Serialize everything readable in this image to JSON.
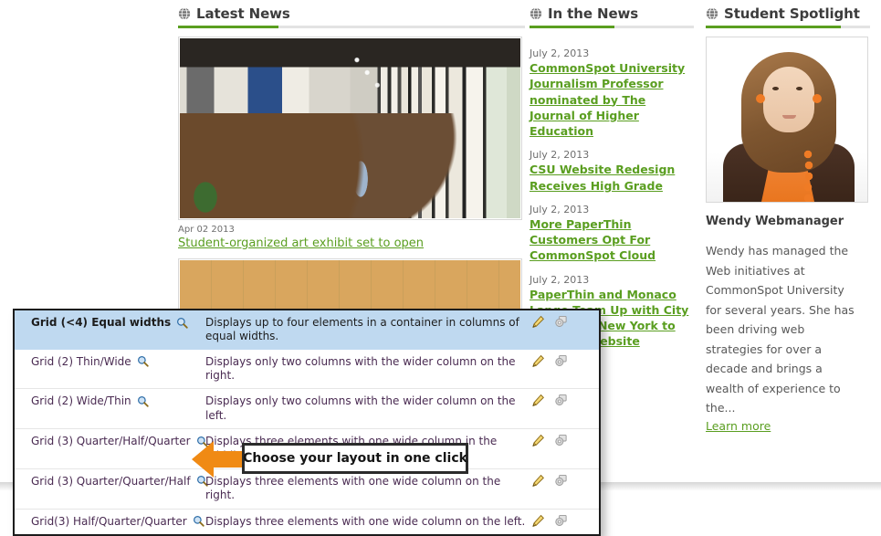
{
  "sections": {
    "latest_news": {
      "title": "Latest News",
      "icon": "globe-icon",
      "featured": {
        "date": "Apr 02 2013",
        "headline": "Student-organized art exhibit set to open",
        "image_alt": "art-gallery-photo"
      },
      "second_image_alt": "group-photo"
    },
    "in_the_news": {
      "title": "In the News",
      "icon": "globe-icon",
      "items": [
        {
          "date": "July 2, 2013",
          "headline": "CommonSpot University Journalism Professor nominated by The Journal of Higher Education"
        },
        {
          "date": "July 2, 2013",
          "headline": "CSU Website Redesign Receives High Grade"
        },
        {
          "date": "July 2, 2013",
          "headline": "More PaperThin Customers Opt For CommonSpot Cloud"
        },
        {
          "date": "July 2, 2013",
          "headline": "PaperThin and Monaco Lange Team Up with City College of New York to Rebrand Website"
        }
      ]
    },
    "student_spotlight": {
      "title": "Student Spotlight",
      "icon": "globe-icon",
      "photo_alt": "student-portrait",
      "name": "Wendy Webmanager",
      "bio": "Wendy has managed the Web initiatives at CommonSpot University for several years. She has been driving web strategies for over a decade and brings a wealth of experience to the...",
      "learn_more": "Learn more"
    }
  },
  "layout_chooser": {
    "rows": [
      {
        "name": "Grid (<4) Equal widths",
        "description": "Displays up to four elements in a container in columns of equal widths.",
        "selected": true
      },
      {
        "name": "Grid (2) Thin/Wide",
        "description": "Displays only two columns with the wider column on the right.",
        "selected": false
      },
      {
        "name": "Grid (2) Wide/Thin",
        "description": "Displays only two columns with the wider column on the left.",
        "selected": false
      },
      {
        "name": "Grid (3) Quarter/Half/Quarter",
        "description": "Displays three elements with one wide column in the middle.",
        "selected": false
      },
      {
        "name": "Grid (3) Quarter/Quarter/Half",
        "description": "Displays three elements with one wide column on the right.",
        "selected": false
      },
      {
        "name": "Grid(3) Half/Quarter/Quarter",
        "description": "Displays three elements with one wide column on the left.",
        "selected": false
      }
    ],
    "row_icons": {
      "preview": "magnifier-icon",
      "edit": "pencil-icon",
      "copy": "copy-icon"
    }
  },
  "callout": {
    "text": "Choose your layout in one click",
    "arrow": "left-arrow-icon"
  },
  "colors": {
    "accent_green": "#5a9e20",
    "selected_row": "#bfd9f0",
    "callout_arrow": "#f08a14",
    "link_purple": "#4a2b52",
    "heading": "#3c3c3c"
  }
}
